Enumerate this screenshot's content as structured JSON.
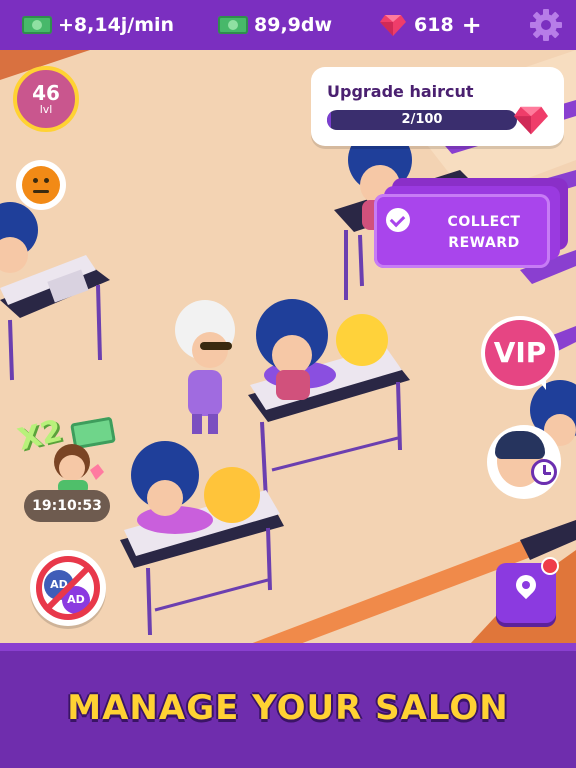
{
  "hud": {
    "income_rate": "+8,14j/min",
    "cash": "89,9dw",
    "gems": "618",
    "gems_plus": "+",
    "icons": [
      "cash-bill-icon",
      "cash-bill-icon",
      "gem-icon",
      "gear-icon"
    ]
  },
  "player": {
    "level_number": "46",
    "level_label": "lvl",
    "mood": "neutral-face-icon"
  },
  "upgrade": {
    "title": "Upgrade haircut",
    "progress_text": "2/100",
    "progress_fraction": 0.02,
    "icon": "gem-icon"
  },
  "collect_reward": {
    "line1": "COLLECT",
    "line2": "REWARD"
  },
  "vip": {
    "label": "VIP"
  },
  "boost": {
    "multiplier": "X2",
    "timer": "19:10:53"
  },
  "no_ads": {
    "ad_a": "AD",
    "ad_b": "AD"
  },
  "banner": {
    "headline": "MANAGE YOUR SALON"
  },
  "colors": {
    "topbar": "#7b2fc0",
    "panel": "#6f2dad",
    "headline": "#ffd233",
    "gem": "#ef3d6a",
    "floor": "#f3d3b3"
  }
}
